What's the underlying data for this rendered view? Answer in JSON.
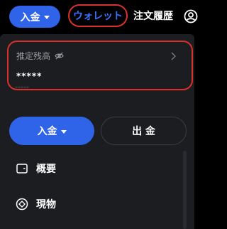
{
  "topbar": {
    "deposit_label": "入金",
    "wallet_tab_label": "ウォレット",
    "history_tab_label": "注文履歴",
    "user_icon": "user-circle-icon"
  },
  "balance": {
    "label": "推定残高",
    "eye_icon": "eye-off-icon",
    "chevron_icon": "chevron-right-icon",
    "value": "*****",
    "sub_value": "*****"
  },
  "actions": {
    "deposit_label": "入金",
    "withdraw_label": "出 金"
  },
  "menu": {
    "items": [
      {
        "label": "概要",
        "icon": "wallet-icon"
      },
      {
        "label": "現物",
        "icon": "spot-diamond-icon"
      }
    ]
  },
  "colors": {
    "primary": "#2f63e8",
    "highlight": "#d9312b",
    "panel": "#1c1d21",
    "link": "#3a70ff"
  }
}
